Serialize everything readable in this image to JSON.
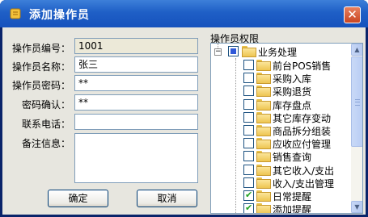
{
  "window": {
    "title": "添加操作员",
    "close_glyph": "✕"
  },
  "form": {
    "fields": [
      {
        "label": "操作员编号：",
        "value": "1001"
      },
      {
        "label": "操作员名称：",
        "value": "张三"
      },
      {
        "label": "操作员密码：",
        "value": "**"
      },
      {
        "label": "密码确认：",
        "value": "**"
      },
      {
        "label": "联系电话：",
        "value": ""
      },
      {
        "label": "备注信息：",
        "value": ""
      }
    ],
    "ok_label": "确定",
    "cancel_label": "取消"
  },
  "permissions": {
    "title": "操作员权限",
    "root": {
      "label": "业务处理",
      "expander": "−",
      "state": "partial"
    },
    "items": [
      {
        "label": "前台POS销售",
        "checked": false
      },
      {
        "label": "采购入库",
        "checked": false
      },
      {
        "label": "采购退货",
        "checked": false
      },
      {
        "label": "库存盘点",
        "checked": false
      },
      {
        "label": "其它库存变动",
        "checked": false
      },
      {
        "label": "商品拆分组装",
        "checked": false
      },
      {
        "label": "应收应付管理",
        "checked": false
      },
      {
        "label": "销售查询",
        "checked": false
      },
      {
        "label": "其它收入/支出",
        "checked": false
      },
      {
        "label": "收入/支出管理",
        "checked": false
      },
      {
        "label": "日常提醒",
        "checked": true
      },
      {
        "label": "添加提醒",
        "checked": true
      }
    ],
    "scroll_up_glyph": "▲",
    "scroll_down_glyph": "▼"
  }
}
